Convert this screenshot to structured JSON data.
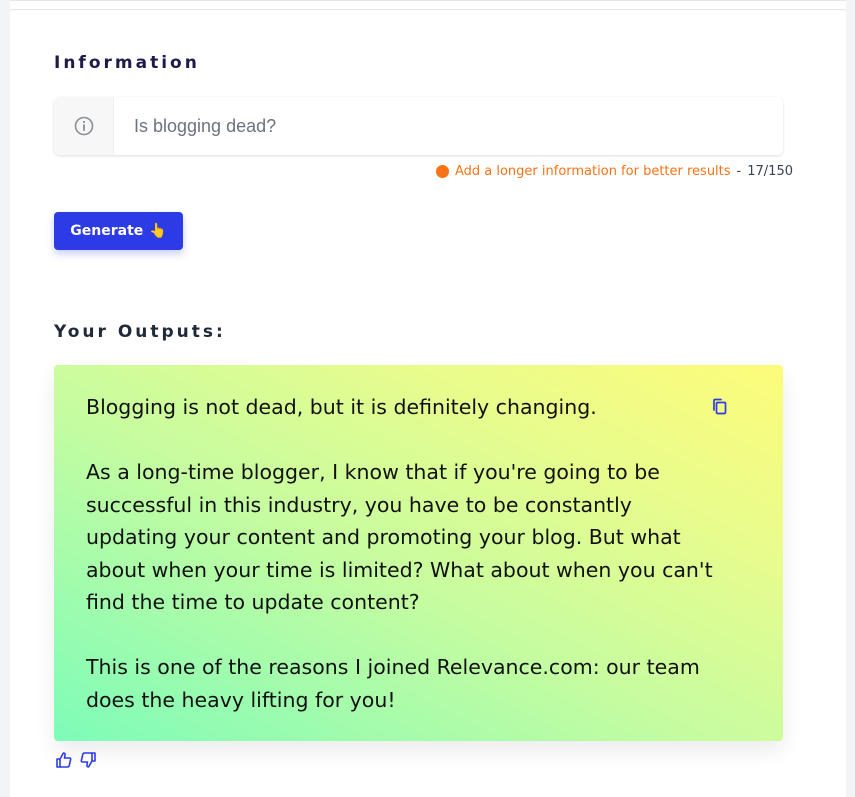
{
  "information": {
    "label": "Information",
    "input_value": "Is blogging dead?",
    "hint": "Add a longer information for better results",
    "hint_separator": "-",
    "char_count": "17/150"
  },
  "actions": {
    "generate_label": "Generate",
    "generate_emoji": "👆"
  },
  "outputs": {
    "label": "Your Outputs:",
    "text": "Blogging is not dead, but it is definitely changing.\n\nAs a long-time blogger, I know that if you're going to be successful in this industry, you have to be constantly updating your content and promoting your blog. But what about when your time is limited? What about when you can't find the time to update content?\n\nThis is one of the reasons I joined Relevance.com: our team does the heavy lifting for you!"
  },
  "icons": {
    "info": "info-circle-icon",
    "copy": "copy-icon",
    "thumbs_up": "thumbs-up-icon",
    "thumbs_down": "thumbs-down-icon"
  },
  "colors": {
    "accent": "#2c3be6",
    "warning": "#f97316",
    "gradient_start": "#7dfcb9",
    "gradient_end": "#fdfc7a"
  }
}
